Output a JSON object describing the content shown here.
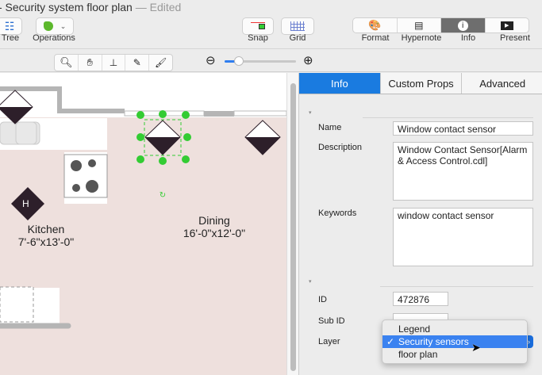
{
  "window": {
    "title": "- Security system floor plan",
    "status": "— Edited"
  },
  "toolbar": {
    "tree": "Tree",
    "operations": "Operations",
    "snap": "Snap",
    "grid": "Grid",
    "format": "Format",
    "hypernote": "Hypernote",
    "info": "Info",
    "present": "Present"
  },
  "zoom": {
    "level": 0.2
  },
  "canvas": {
    "kitchen_name": "Kitchen",
    "kitchen_size": "7'-6\"x13'-0\"",
    "dining_name": "Dining",
    "dining_size": "16'-0\"x12'-0\"",
    "heat_label": "H"
  },
  "panel": {
    "tabs": [
      "Info",
      "Custom Props",
      "Advanced"
    ],
    "name_label": "Name",
    "name_value": "Window contact sensor",
    "description_label": "Description",
    "description_value": "Window Contact Sensor[Alarm & Access Control.cdl]",
    "keywords_label": "Keywords",
    "keywords_value": "window contact sensor",
    "id_label": "ID",
    "id_value": "472876",
    "subid_label": "Sub ID",
    "layer_label": "Layer",
    "layer_options": [
      "Legend",
      "Security sensors",
      "floor plan"
    ],
    "layer_selected": "Security sensors",
    "check": "✓"
  }
}
